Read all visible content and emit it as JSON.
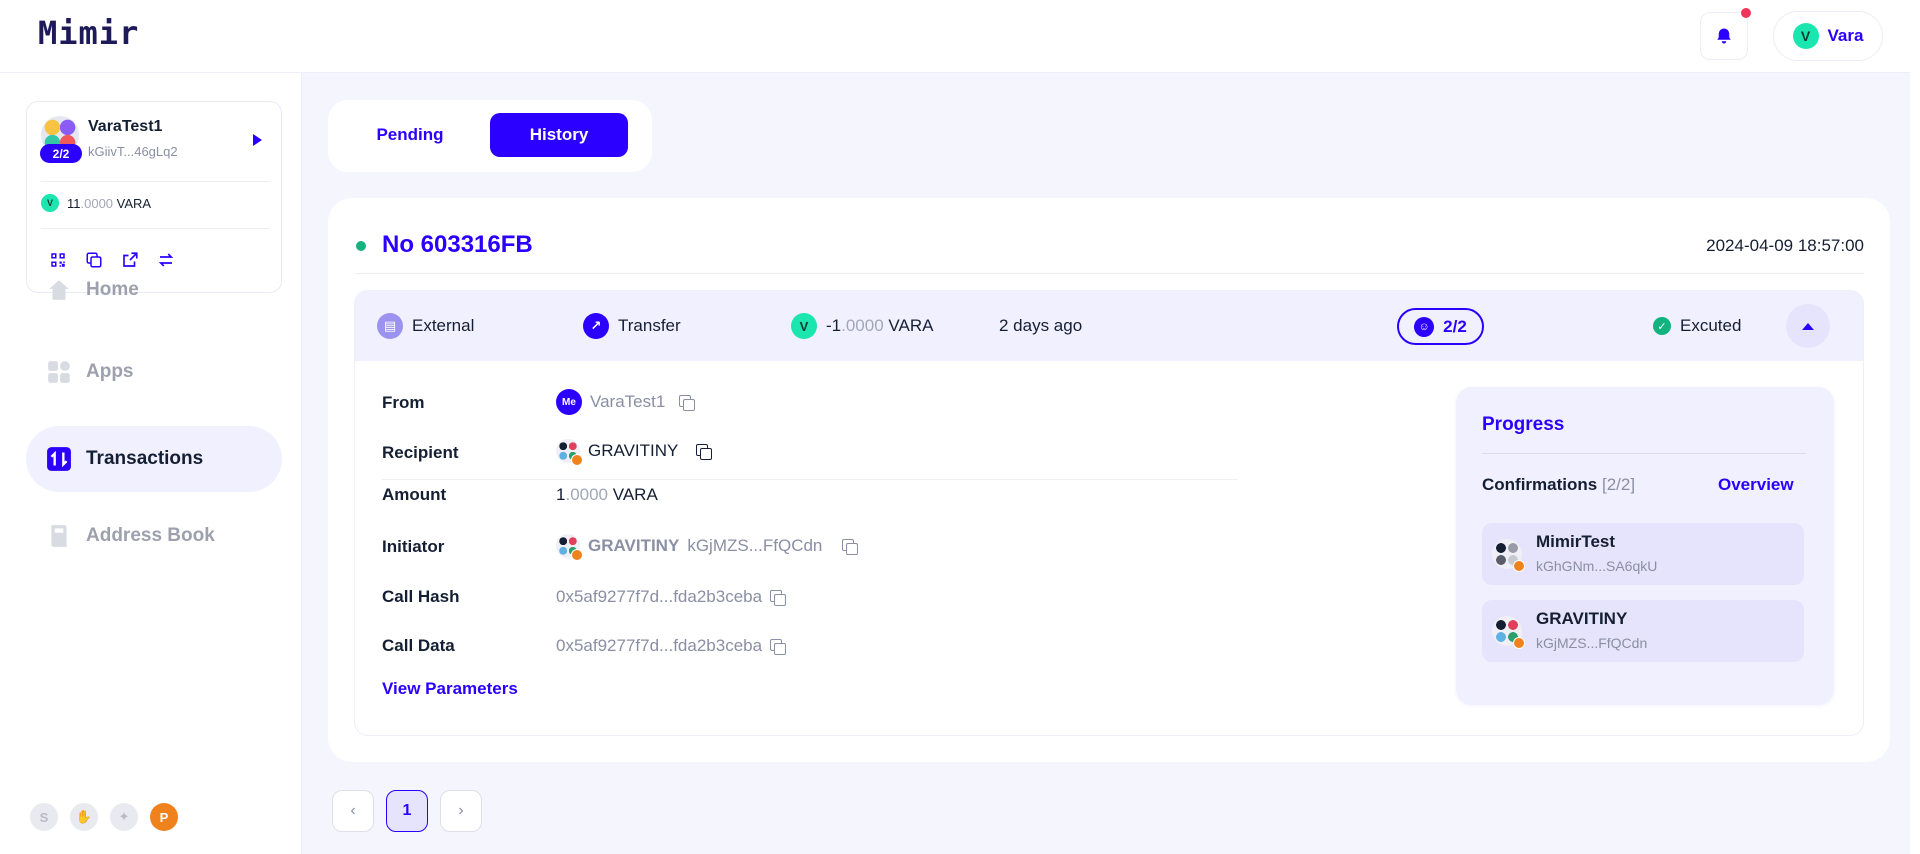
{
  "app": {
    "logo": "Mimir"
  },
  "header": {
    "network": {
      "label": "Vara",
      "icon": "vara-icon"
    },
    "notifications_icon": "bell-icon"
  },
  "account": {
    "name": "VaraTest1",
    "address": "kGiivT...46gLq2",
    "threshold": "2/2",
    "balance_int": "11",
    "balance_dec": ".0000",
    "balance_unit": "VARA"
  },
  "nav": {
    "items": [
      {
        "label": "Home",
        "icon": "home-icon"
      },
      {
        "label": "Apps",
        "icon": "apps-icon"
      },
      {
        "label": "Transactions",
        "icon": "transactions-icon"
      },
      {
        "label": "Address Book",
        "icon": "address-book-icon"
      }
    ]
  },
  "tabs": {
    "pending": "Pending",
    "history": "History"
  },
  "tx": {
    "title": "No 603316FB",
    "time": "2024-04-09 18:57:00",
    "summary": {
      "type": "External",
      "action": "Transfer",
      "amount_int": "-1",
      "amount_dec": ".0000",
      "amount_unit": "VARA",
      "ago": "2 days ago",
      "members": "2/2",
      "status": "Excuted"
    },
    "fields": {
      "from_label": "From",
      "from_me": "Me",
      "from_value": "VaraTest1",
      "recipient_label": "Recipient",
      "recipient_value": "GRAVITINY",
      "amount_label": "Amount",
      "amount_int": "1",
      "amount_dec": ".0000",
      "amount_unit": "VARA",
      "initiator_label": "Initiator",
      "initiator_name": "GRAVITINY",
      "initiator_addr": "kGjMZS...FfQCdn",
      "call_hash_label": "Call Hash",
      "call_hash_value": "0x5af9277f7d...fda2b3ceba",
      "call_data_label": "Call Data",
      "call_data_value": "0x5af9277f7d...fda2b3ceba",
      "view_params": "View Parameters"
    },
    "progress": {
      "title": "Progress",
      "confirmations_label": "Confirmations",
      "confirmations_count": "[2/2]",
      "overview": "Overview",
      "members": [
        {
          "name": "MimirTest",
          "address": "kGhGNm...SA6qkU"
        },
        {
          "name": "GRAVITINY",
          "address": "kGjMZS...FfQCdn"
        }
      ]
    }
  },
  "pagination": {
    "current": "1"
  },
  "colors": {
    "accent": "#2B00FF",
    "success": "#13B37F",
    "vara": "#1BE6B0",
    "polkadot": "#F0821E"
  }
}
